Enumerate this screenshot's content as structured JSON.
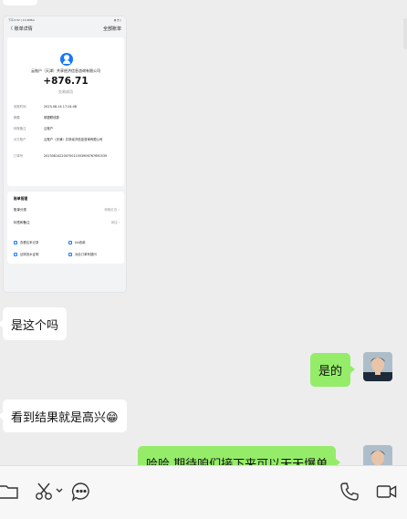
{
  "shared_image": {
    "status_time": "下午4:32 | 11:0KB/s",
    "status_icons": "▮ ◔ ▯",
    "nav_back": "〈",
    "nav_title": "账单详情",
    "nav_action": "全部账单",
    "payee": "云账户（天津）共享经济信息咨询有限公司",
    "amount": "+876.71",
    "status": "交易成功",
    "details": [
      {
        "k": "到账时间",
        "v": "2023-08-14 17:24:08"
      },
      {
        "k": "摘要",
        "v": "绑银联线算"
      },
      {
        "k": "转账备注",
        "v": "云账户"
      },
      {
        "k": "对方账户",
        "v": "云账户（天津）共享经济信息咨询有限公司"
      },
      {
        "k": "订单号",
        "v": "20230814220070011503906767650339"
      }
    ],
    "manage_title": "账单管理",
    "manage_rows": [
      {
        "k": "账单分类",
        "v": "转账红包 ›"
      },
      {
        "k": "标签和备注",
        "v": "添加 ›"
      }
    ],
    "links": [
      "查看往来记录",
      "AA收款",
      "证明流水证明",
      "对此订单有疑问"
    ]
  },
  "messages": [
    {
      "side": "in",
      "text": "是这个吗"
    },
    {
      "side": "out",
      "text": "是的"
    },
    {
      "side": "in",
      "text": "看到结果就是高兴😁"
    },
    {
      "side": "out",
      "text": "哈哈 期待咱们接下来可以天天爆单"
    }
  ],
  "toolbar": {
    "folder_icon": "folder-icon",
    "scissors_icon": "scissors-icon",
    "chat_icon": "chat-bubble-icon",
    "phone_icon": "phone-icon",
    "video_icon": "video-icon"
  },
  "colors": {
    "out_bubble": "#95ec69",
    "in_bubble": "#ffffff",
    "bg": "#ededed"
  }
}
